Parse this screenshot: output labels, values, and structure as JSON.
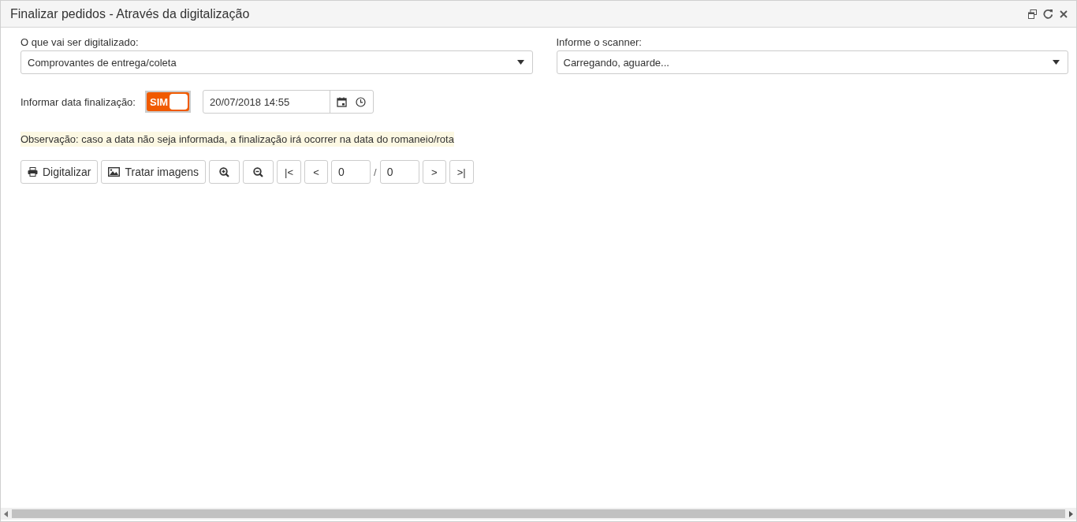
{
  "window": {
    "title": "Finalizar pedidos - Através da digitalização"
  },
  "fields": [
    {
      "label": "O que vai ser digitalizado:",
      "value": "Comprovantes de entrega/coleta"
    },
    {
      "label": "Informe o scanner:",
      "value": "Carregando, aguarde..."
    }
  ],
  "date_row": {
    "label": "Informar data finalização:",
    "toggle": {
      "on": true,
      "text": "SIM"
    },
    "date_value": "20/07/2018 14:55"
  },
  "note": "Observação: caso a data não seja informada, a finalização irá ocorrer na data do romaneio/rota",
  "toolbar": [
    {
      "kind": "printer",
      "label": "Digitalizar"
    },
    {
      "kind": "image",
      "label": "Tratar imagens"
    },
    {
      "kind": "zoom-in"
    },
    {
      "kind": "zoom-out"
    },
    {
      "kind": "text",
      "label": "|<"
    },
    {
      "kind": "text",
      "label": "<"
    },
    {
      "kind": "input",
      "value": "0"
    },
    {
      "kind": "sep",
      "label": "/"
    },
    {
      "kind": "input",
      "value": "0"
    },
    {
      "kind": "text",
      "label": ">"
    },
    {
      "kind": "text",
      "label": ">|"
    }
  ]
}
